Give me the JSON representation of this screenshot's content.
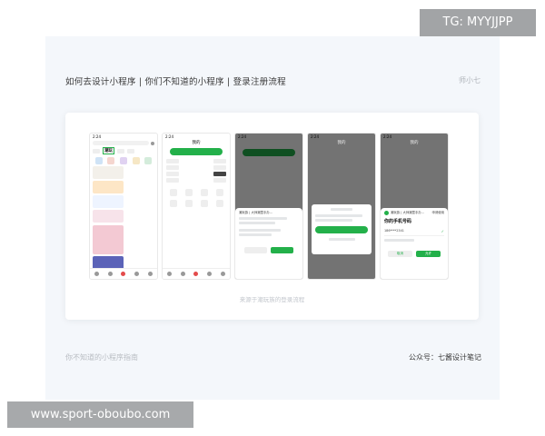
{
  "slide": {
    "title": "如何去设计小程序 | 你们不知道的小程序 | 登录注册流程",
    "author": "师小七",
    "caption": "来源于潮玩族的登录流程",
    "footer_left": "你不知道的小程序指南",
    "footer_right": "公众号：七酱设计笔记"
  },
  "watermarks": {
    "top_right": "TG: MYYJJPP",
    "bottom_left": "www.sport-oboubo.com"
  },
  "phones": [
    {
      "time": "2:24",
      "tab": "潮玩",
      "header": ""
    },
    {
      "time": "2:24",
      "tab": "",
      "header": "我的"
    },
    {
      "time": "2:24",
      "tab": "",
      "header": ""
    },
    {
      "time": "2:24",
      "tab": "",
      "header": "我的"
    },
    {
      "time": "2:24",
      "tab": "",
      "header": "我的"
    }
  ],
  "sheet_login": {
    "title": "潮玩族 | 大师潮童手办...",
    "subtitle": "申请使用",
    "prompt": "你的手机号码",
    "phone_masked": "186****2341",
    "cancel": "取消",
    "allow": "允许"
  },
  "colors": {
    "accent_green": "#23b04a",
    "slide_bg": "#f4f7fb"
  }
}
